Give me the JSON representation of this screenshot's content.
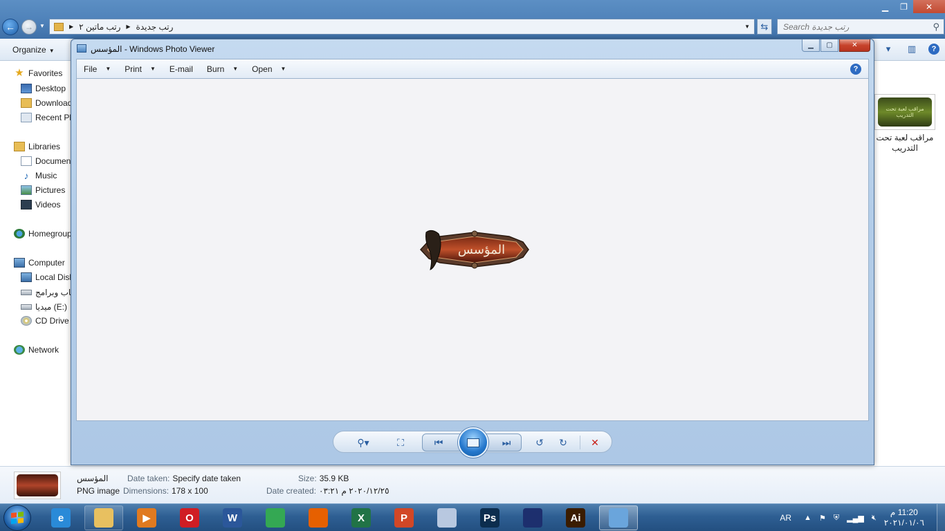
{
  "explorer": {
    "address": {
      "crumbs": [
        "رتب ماتين ٢",
        "رتب جديدة"
      ],
      "refresh_icon": "refresh-icon"
    },
    "search": {
      "placeholder": "Search رتب جديدة"
    },
    "toolbar": {
      "organize_label": "Organize"
    },
    "nav": {
      "favorites": "Favorites",
      "desktop": "Desktop",
      "downloads": "Downloads",
      "recent": "Recent Places",
      "libraries": "Libraries",
      "documents": "Documents",
      "music": "Music",
      "pictures": "Pictures",
      "videos": "Videos",
      "homegroup": "Homegroup",
      "computer": "Computer",
      "local_disk": "Local Disk",
      "games_drive": "العاب وبرامج",
      "media_drive": "ميديا (E:)",
      "cd_drive": "CD Drive",
      "network": "Network"
    },
    "file_item": {
      "name": "مراقب لعبة تحت التدريب",
      "thumb_text": "مراقب لعبة تحت التدريب"
    },
    "details": {
      "name": "المؤسس",
      "type": "PNG image",
      "date_taken_label": "Date taken:",
      "date_taken_value": "Specify date taken",
      "dimensions_label": "Dimensions:",
      "dimensions_value": "178 x 100",
      "size_label": "Size:",
      "size_value": "35.9 KB",
      "date_created_label": "Date created:",
      "date_created_value": "٢٠٢٠/١٢/٢٥ م ٠٣:٢١"
    }
  },
  "viewer": {
    "title_image": "المؤسس",
    "title_app": " - Windows Photo Viewer",
    "menu": {
      "file": "File",
      "print": "Print",
      "email": "E-mail",
      "burn": "Burn",
      "open": "Open"
    },
    "image_text": "المؤسس"
  },
  "taskbar": {
    "language": "AR",
    "time": "11:20 م",
    "date": "٢٠٢١/٠١/٠٦",
    "apps": [
      {
        "name": "internet-explorer",
        "glyph": "e",
        "color": "#2a8ad8"
      },
      {
        "name": "file-explorer",
        "glyph": "",
        "color": "#e8c060"
      },
      {
        "name": "media-player",
        "glyph": "▶",
        "color": "#e07a20"
      },
      {
        "name": "opera",
        "glyph": "O",
        "color": "#d01d24"
      },
      {
        "name": "word",
        "glyph": "W",
        "color": "#2b579a"
      },
      {
        "name": "chrome",
        "glyph": "",
        "color": "#34a853"
      },
      {
        "name": "firefox",
        "glyph": "",
        "color": "#e66000"
      },
      {
        "name": "excel",
        "glyph": "X",
        "color": "#217346"
      },
      {
        "name": "powerpoint",
        "glyph": "P",
        "color": "#d24726"
      },
      {
        "name": "paint",
        "glyph": "",
        "color": "#b8c8e0"
      },
      {
        "name": "photoshop",
        "glyph": "Ps",
        "color": "#0c2d4e"
      },
      {
        "name": "eye-app",
        "glyph": "",
        "color": "#1d2f6e"
      },
      {
        "name": "illustrator",
        "glyph": "Ai",
        "color": "#3a1c00"
      },
      {
        "name": "photo-viewer",
        "glyph": "",
        "color": "#6aa5dc"
      }
    ]
  }
}
